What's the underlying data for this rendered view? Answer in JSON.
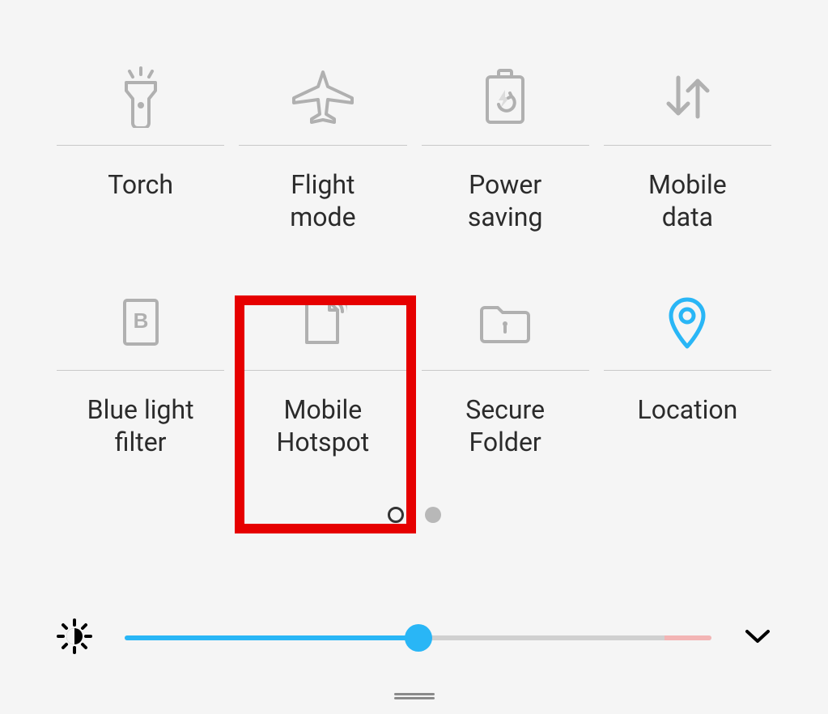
{
  "tiles": {
    "torch": {
      "label": "Torch",
      "active": false
    },
    "flight_mode": {
      "label": "Flight\nmode",
      "active": false
    },
    "power_saving": {
      "label": "Power\nsaving",
      "active": false
    },
    "mobile_data": {
      "label": "Mobile\ndata",
      "active": false
    },
    "blue_light": {
      "label": "Blue light\nfilter",
      "active": false
    },
    "mobile_hotspot": {
      "label": "Mobile\nHotspot",
      "active": false,
      "highlighted": true
    },
    "secure_folder": {
      "label": "Secure\nFolder",
      "active": false
    },
    "location": {
      "label": "Location",
      "active": true
    }
  },
  "pager": {
    "current": 0,
    "total": 2
  },
  "brightness": {
    "value_percent": 50
  },
  "colors": {
    "active": "#29b6f6",
    "inactive": "#b0b0b0",
    "highlight": "#e60000"
  }
}
